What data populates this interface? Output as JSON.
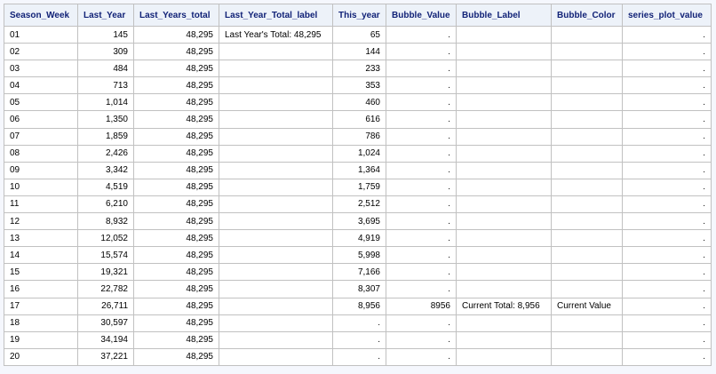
{
  "table": {
    "columns": [
      "Season_Week",
      "Last_Year",
      "Last_Years_total",
      "Last_Year_Total_label",
      "This_year",
      "Bubble_Value",
      "Bubble_Label",
      "Bubble_Color",
      "series_plot_value"
    ],
    "rows": [
      [
        "01",
        "145",
        "48,295",
        "Last Year's Total: 48,295",
        "65",
        ".",
        "",
        "",
        "."
      ],
      [
        "02",
        "309",
        "48,295",
        "",
        "144",
        ".",
        "",
        "",
        "."
      ],
      [
        "03",
        "484",
        "48,295",
        "",
        "233",
        ".",
        "",
        "",
        "."
      ],
      [
        "04",
        "713",
        "48,295",
        "",
        "353",
        ".",
        "",
        "",
        "."
      ],
      [
        "05",
        "1,014",
        "48,295",
        "",
        "460",
        ".",
        "",
        "",
        "."
      ],
      [
        "06",
        "1,350",
        "48,295",
        "",
        "616",
        ".",
        "",
        "",
        "."
      ],
      [
        "07",
        "1,859",
        "48,295",
        "",
        "786",
        ".",
        "",
        "",
        "."
      ],
      [
        "08",
        "2,426",
        "48,295",
        "",
        "1,024",
        ".",
        "",
        "",
        "."
      ],
      [
        "09",
        "3,342",
        "48,295",
        "",
        "1,364",
        ".",
        "",
        "",
        "."
      ],
      [
        "10",
        "4,519",
        "48,295",
        "",
        "1,759",
        ".",
        "",
        "",
        "."
      ],
      [
        "11",
        "6,210",
        "48,295",
        "",
        "2,512",
        ".",
        "",
        "",
        "."
      ],
      [
        "12",
        "8,932",
        "48,295",
        "",
        "3,695",
        ".",
        "",
        "",
        "."
      ],
      [
        "13",
        "12,052",
        "48,295",
        "",
        "4,919",
        ".",
        "",
        "",
        "."
      ],
      [
        "14",
        "15,574",
        "48,295",
        "",
        "5,998",
        ".",
        "",
        "",
        "."
      ],
      [
        "15",
        "19,321",
        "48,295",
        "",
        "7,166",
        ".",
        "",
        "",
        "."
      ],
      [
        "16",
        "22,782",
        "48,295",
        "",
        "8,307",
        ".",
        "",
        "",
        "."
      ],
      [
        "17",
        "26,711",
        "48,295",
        "",
        "8,956",
        "8956",
        "Current Total: 8,956",
        "Current Value",
        "."
      ],
      [
        "18",
        "30,597",
        "48,295",
        "",
        ".",
        ".",
        "",
        "",
        "."
      ],
      [
        "19",
        "34,194",
        "48,295",
        "",
        ".",
        ".",
        "",
        "",
        "."
      ],
      [
        "20",
        "37,221",
        "48,295",
        "",
        ".",
        ".",
        "",
        "",
        "."
      ]
    ]
  }
}
